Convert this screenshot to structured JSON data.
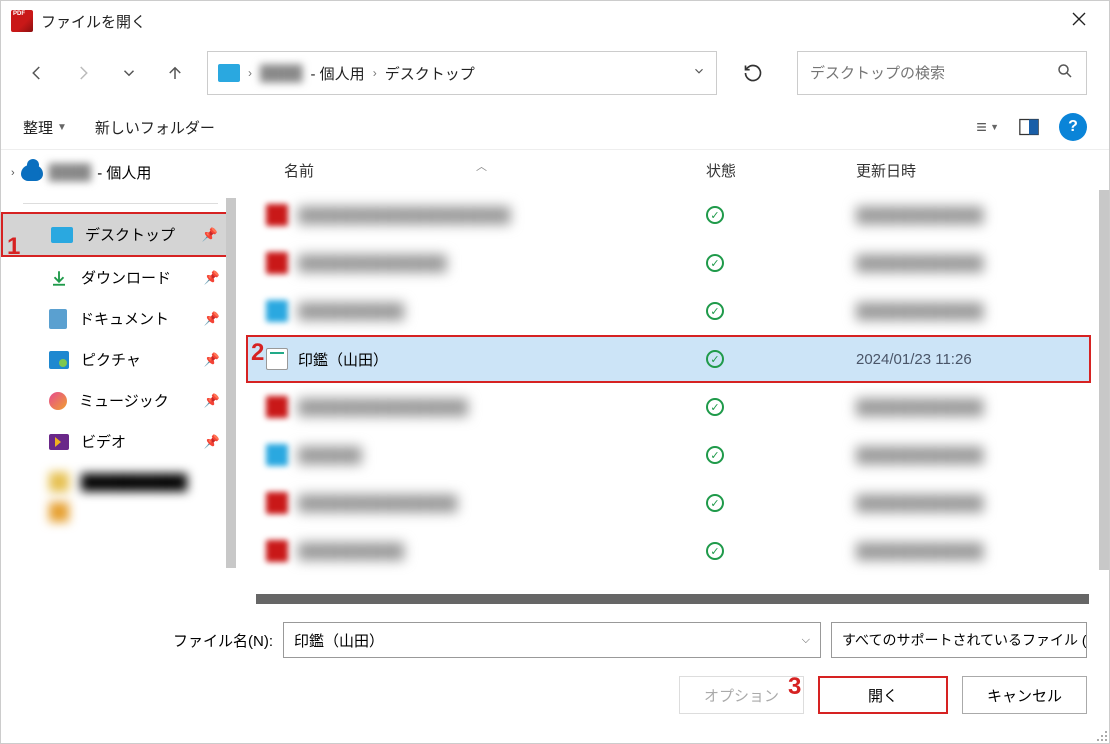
{
  "window": {
    "title": "ファイルを開く"
  },
  "breadcrumb": {
    "user_suffix": " - 個人用",
    "end": "デスクトップ"
  },
  "search": {
    "placeholder": "デスクトップの検索"
  },
  "toolbar": {
    "organize": "整理",
    "newfolder": "新しいフォルダー"
  },
  "sidebar": {
    "root_suffix": " - 個人用",
    "items": [
      {
        "label": "デスクトップ"
      },
      {
        "label": "ダウンロード"
      },
      {
        "label": "ドキュメント"
      },
      {
        "label": "ピクチャ"
      },
      {
        "label": "ミュージック"
      },
      {
        "label": "ビデオ"
      }
    ]
  },
  "columns": {
    "name": "名前",
    "status": "状態",
    "date": "更新日時"
  },
  "selected_file": {
    "name": "印鑑（山田）",
    "date": "2024/01/23 11:26"
  },
  "footer": {
    "filename_label": "ファイル名(N):",
    "filename_value": "印鑑（山田）",
    "filetype": "すべてのサポートされているファイル (*",
    "options": "オプション",
    "open": "開く",
    "cancel": "キャンセル"
  },
  "annotations": {
    "a1": "1",
    "a2": "2",
    "a3": "3"
  }
}
